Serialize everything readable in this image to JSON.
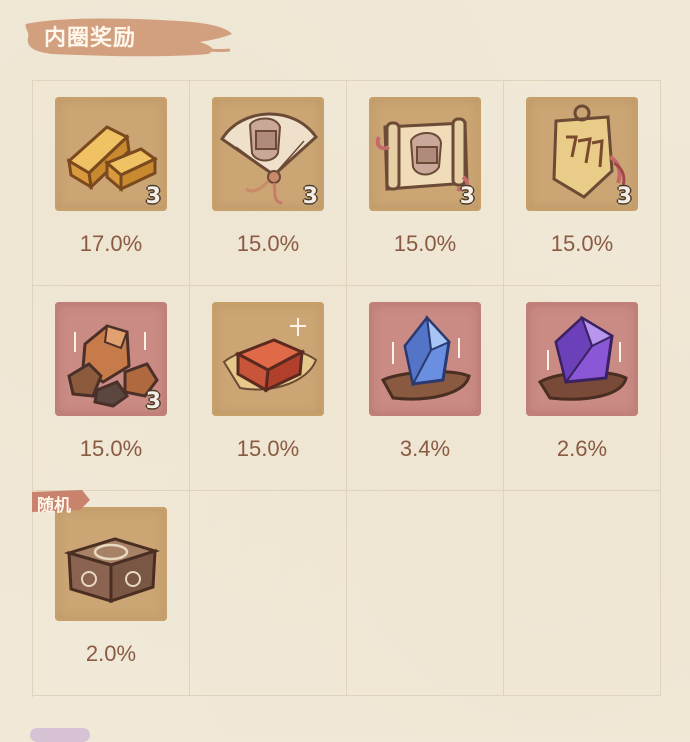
{
  "header": {
    "title": "内圈奖励"
  },
  "items": [
    {
      "icon": "gold-bars-icon",
      "frame": "gold",
      "count": "3",
      "rate": "17.0%"
    },
    {
      "icon": "fan-icon",
      "frame": "gold",
      "count": "3",
      "rate": "15.0%"
    },
    {
      "icon": "scroll-icon",
      "frame": "gold",
      "count": "3",
      "rate": "15.0%"
    },
    {
      "icon": "token-plaque-icon",
      "frame": "gold",
      "count": "3",
      "rate": "15.0%"
    },
    {
      "icon": "ore-rocks-icon",
      "frame": "red",
      "count": "3",
      "rate": "15.0%"
    },
    {
      "icon": "red-ingot-icon",
      "frame": "gold",
      "count": "",
      "rate": "15.0%"
    },
    {
      "icon": "blue-crystal-icon",
      "frame": "red",
      "count": "",
      "rate": "3.4%"
    },
    {
      "icon": "purple-crystal-icon",
      "frame": "red",
      "count": "",
      "rate": "2.6%"
    },
    {
      "icon": "treasure-chest-icon",
      "frame": "gold",
      "count": "",
      "rate": "2.0%",
      "tag": "随机"
    }
  ]
}
